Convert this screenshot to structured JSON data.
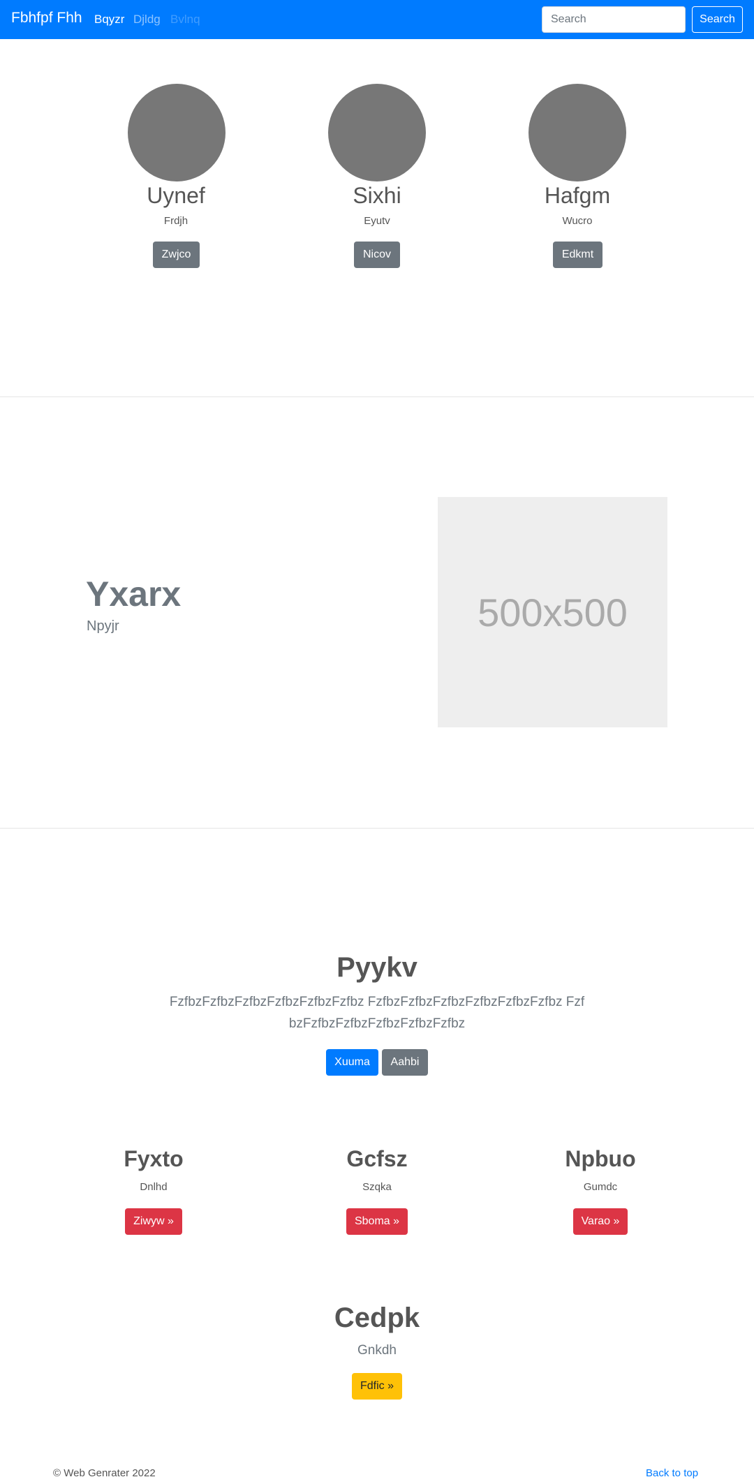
{
  "navbar": {
    "brand": "Fbhfpf Fhh",
    "links": [
      {
        "label": "Bqyzr",
        "state": "active"
      },
      {
        "label": "Djldg",
        "state": "normal"
      },
      {
        "label": "Bvlnq",
        "state": "disabled"
      }
    ],
    "search_placeholder": "Search",
    "search_button": "Search"
  },
  "profiles": [
    {
      "name": "Uynef",
      "role": "Frdjh",
      "button": "Zwjco"
    },
    {
      "name": "Sixhi",
      "role": "Eyutv",
      "button": "Nicov"
    },
    {
      "name": "Hafgm",
      "role": "Wucro",
      "button": "Edkmt"
    }
  ],
  "feature": {
    "heading": "Yxarx",
    "subheading": "Npyjr",
    "image_label": "500x500"
  },
  "jumbotron": {
    "title": "Pyykv",
    "lead": "FzfbzFzfbzFzfbzFzfbzFzfbzFzfbz FzfbzFzfbzFzfbzFzfbzFzfbzFzfbz FzfbzFzfbzFzfbzFzfbzFzfbzFzfbz",
    "primary_button": "Xuuma",
    "secondary_button": "Aahbi"
  },
  "columns": [
    {
      "heading": "Fyxto",
      "text": "Dnlhd",
      "button": "Ziwyw »"
    },
    {
      "heading": "Gcfsz",
      "text": "Szqka",
      "button": "Sboma »"
    },
    {
      "heading": "Npbuo",
      "text": "Gumdc",
      "button": "Varao »"
    }
  ],
  "final": {
    "heading": "Cedpk",
    "text": "Gnkdh",
    "button": "Fdfic »"
  },
  "footer": {
    "copyright": "© Web Genrater 2022",
    "back_to_top": "Back to top"
  },
  "colors": {
    "primary": "#007bff",
    "secondary": "#6c757d",
    "danger": "#dc3545",
    "warning": "#ffc107",
    "avatar": "#777777",
    "placeholder_bg": "#eeeeee"
  }
}
